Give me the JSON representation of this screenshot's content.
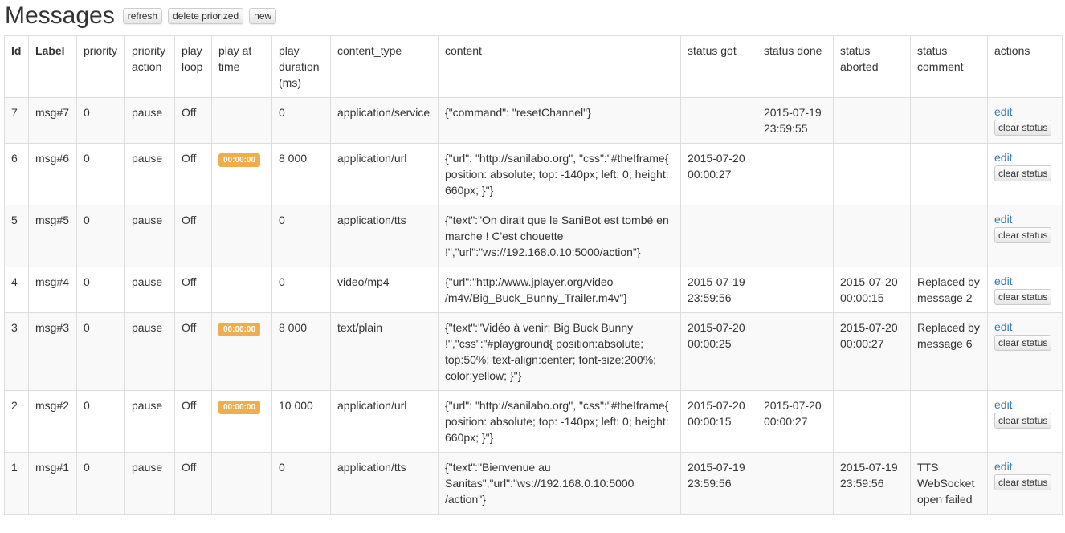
{
  "header": {
    "title": "Messages",
    "buttons": {
      "refresh": "refresh",
      "delete_priorized": "delete priorized",
      "new": "new"
    }
  },
  "table": {
    "columns": {
      "id": "Id",
      "label": "Label",
      "priority": "priority",
      "priority_action": "priority action",
      "play_loop": "play loop",
      "play_at_time": "play at time",
      "play_duration": "play duration (ms)",
      "content_type": "content_type",
      "content": "content",
      "status_got": "status got",
      "status_done": "status done",
      "status_aborted": "status aborted",
      "status_comment": "status comment",
      "actions": "actions"
    },
    "action_labels": {
      "edit": "edit",
      "clear_status": "clear status"
    },
    "rows": [
      {
        "id": "7",
        "label": "msg#7",
        "priority": "0",
        "priority_action": "pause",
        "play_loop": "Off",
        "play_at_time": "",
        "play_duration": "0",
        "content_type": "application/service",
        "content": "{\"command\": \"resetChannel\"}",
        "status_got": "",
        "status_done": "2015-07-19 23:59:55",
        "status_aborted": "",
        "status_comment": ""
      },
      {
        "id": "6",
        "label": "msg#6",
        "priority": "0",
        "priority_action": "pause",
        "play_loop": "Off",
        "play_at_time": "00:00:00",
        "play_duration": "8 000",
        "content_type": "application/url",
        "content": "{\"url\": \"http://sanilabo.org\", \"css\":\"#theIframe{ position: absolute; top: -140px; left: 0; height: 660px; }\"}",
        "status_got": "2015-07-20 00:00:27",
        "status_done": "",
        "status_aborted": "",
        "status_comment": ""
      },
      {
        "id": "5",
        "label": "msg#5",
        "priority": "0",
        "priority_action": "pause",
        "play_loop": "Off",
        "play_at_time": "",
        "play_duration": "0",
        "content_type": "application/tts",
        "content": "{\"text\":\"On dirait que le SaniBot est tombé en marche ! C'est chouette !\",\"url\":\"ws://192.168.0.10:5000/action\"}",
        "status_got": "",
        "status_done": "",
        "status_aborted": "",
        "status_comment": ""
      },
      {
        "id": "4",
        "label": "msg#4",
        "priority": "0",
        "priority_action": "pause",
        "play_loop": "Off",
        "play_at_time": "",
        "play_duration": "0",
        "content_type": "video/mp4",
        "content": "{\"url\":\"http://www.jplayer.org/video /m4v/Big_Buck_Bunny_Trailer.m4v\"}",
        "status_got": "2015-07-19 23:59:56",
        "status_done": "",
        "status_aborted": "2015-07-20 00:00:15",
        "status_comment": "Replaced by message 2"
      },
      {
        "id": "3",
        "label": "msg#3",
        "priority": "0",
        "priority_action": "pause",
        "play_loop": "Off",
        "play_at_time": "00:00:00",
        "play_duration": "8 000",
        "content_type": "text/plain",
        "content": "{\"text\":\"Vidéo à venir: Big Buck Bunny !\",\"css\":\"#playground{ position:absolute; top:50%; text-align:center; font-size:200%; color:yellow; }\"}",
        "status_got": "2015-07-20 00:00:25",
        "status_done": "",
        "status_aborted": "2015-07-20 00:00:27",
        "status_comment": "Replaced by message 6"
      },
      {
        "id": "2",
        "label": "msg#2",
        "priority": "0",
        "priority_action": "pause",
        "play_loop": "Off",
        "play_at_time": "00:00:00",
        "play_duration": "10 000",
        "content_type": "application/url",
        "content": "{\"url\": \"http://sanilabo.org\", \"css\":\"#theIframe{ position: absolute; top: -140px; left: 0; height: 660px; }\"}",
        "status_got": "2015-07-20 00:00:15",
        "status_done": "2015-07-20 00:00:27",
        "status_aborted": "",
        "status_comment": ""
      },
      {
        "id": "1",
        "label": "msg#1",
        "priority": "0",
        "priority_action": "pause",
        "play_loop": "Off",
        "play_at_time": "",
        "play_duration": "0",
        "content_type": "application/tts",
        "content": "{\"text\":\"Bienvenue au Sanitas\",\"url\":\"ws://192.168.0.10:5000 /action\"}",
        "status_got": "2015-07-19 23:59:56",
        "status_done": "",
        "status_aborted": "2015-07-19 23:59:56",
        "status_comment": "TTS WebSocket open failed"
      }
    ]
  },
  "colors": {
    "badge": "#f0ad4e",
    "link": "#337ab7",
    "border": "#dddddd",
    "stripe": "#f9f9f9"
  }
}
